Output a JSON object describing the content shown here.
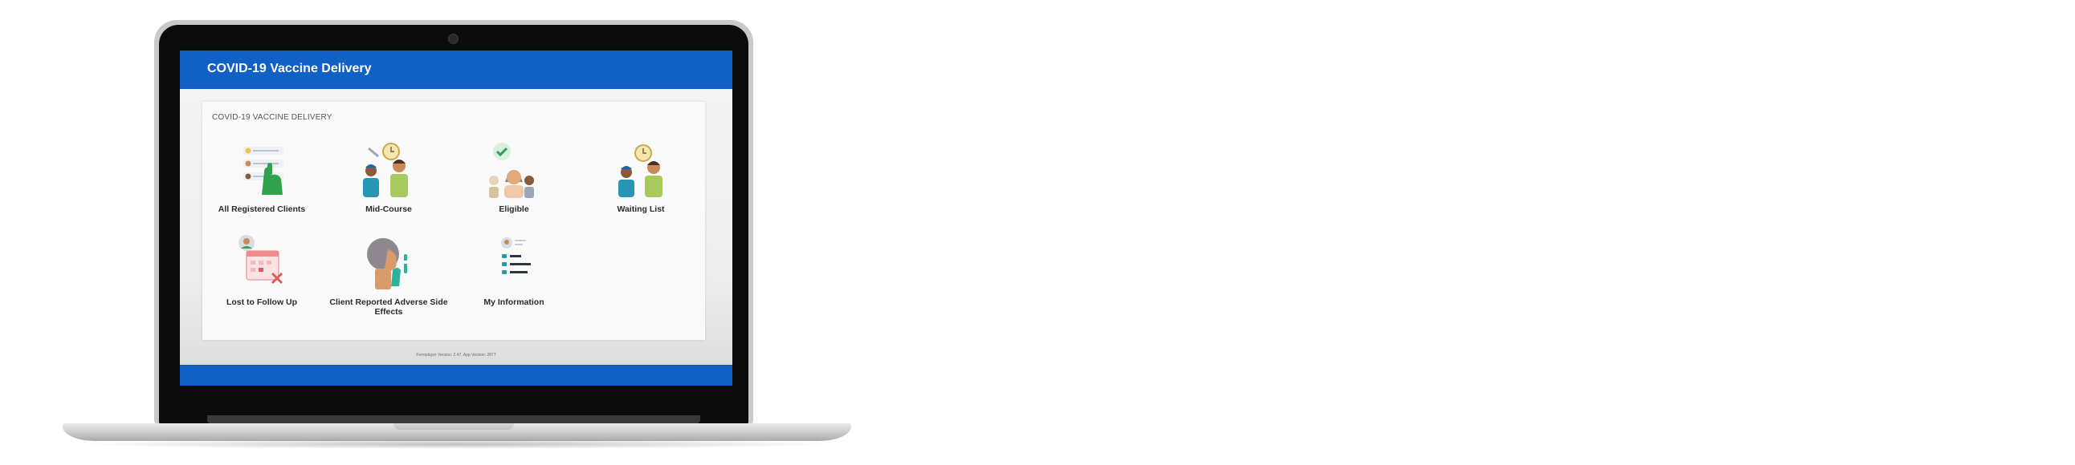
{
  "app": {
    "header_title": "COVID-19 Vaccine Delivery",
    "card_title": "COVID-19 VACCINE DELIVERY",
    "version_text": "Formplayer Version: 2.47, App Version: 2877"
  },
  "tiles": [
    {
      "label": "All Registered Clients",
      "icon": "registered-clients-icon"
    },
    {
      "label": "Mid-Course",
      "icon": "mid-course-icon"
    },
    {
      "label": "Eligible",
      "icon": "eligible-icon"
    },
    {
      "label": "Waiting List",
      "icon": "waiting-list-icon"
    },
    {
      "label": "Lost to Follow Up",
      "icon": "lost-to-follow-up-icon"
    },
    {
      "label": "Client Reported Adverse Side Effects",
      "icon": "adverse-effects-icon"
    },
    {
      "label": "My Information",
      "icon": "my-information-icon"
    }
  ],
  "colors": {
    "brand_blue": "#1160c6",
    "accent_green": "#2fa24b",
    "accent_red": "#e05a5a"
  }
}
